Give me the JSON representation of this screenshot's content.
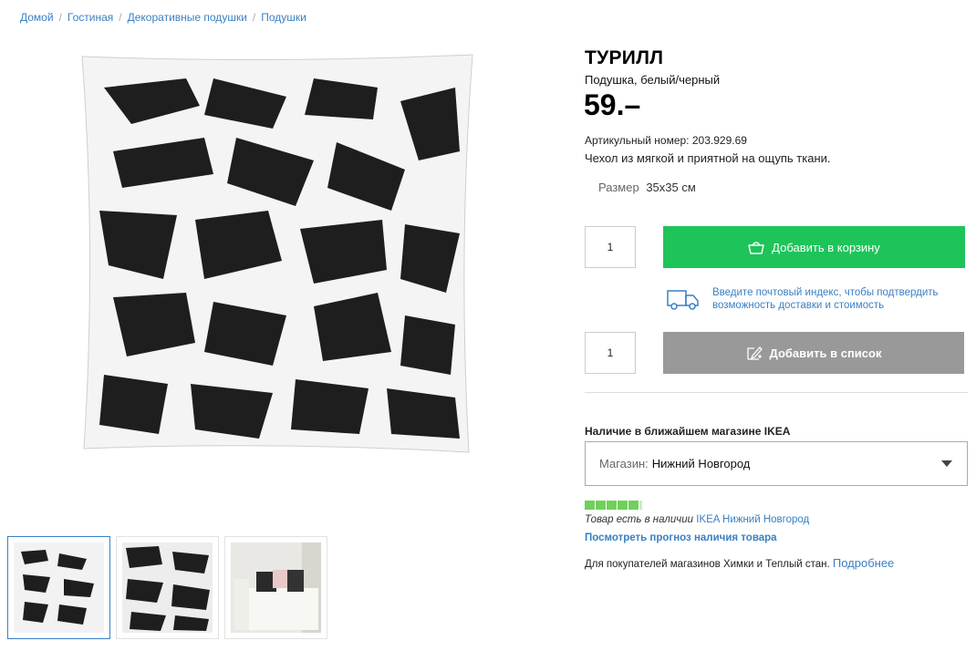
{
  "breadcrumb": {
    "items": [
      "Домой",
      "Гостиная",
      "Декоративные подушки",
      "Подушки"
    ],
    "separator": "/"
  },
  "product": {
    "name": "ТУРИЛЛ",
    "subtitle": "Подушка, белый/черный",
    "price": "59.–",
    "article_label": "Артикульный номер:",
    "article_number": "203.929.69",
    "description": "Чехол из мягкой и приятной на ощупь ткани.",
    "size_label": "Размер",
    "size_value": "35x35 см"
  },
  "cart": {
    "quantity": "1",
    "add_to_cart_label": "Добавить в корзину",
    "button_color": "#1ec45a",
    "icon": "basket-icon"
  },
  "delivery": {
    "text": "Введите почтовый индекс, чтобы подтвердить возможность доставки и стоимость",
    "icon": "truck-icon"
  },
  "list": {
    "quantity": "1",
    "add_to_list_label": "Добавить в список",
    "button_color": "#999999",
    "icon": "list-pen-icon"
  },
  "store": {
    "heading": "Наличие в ближайшем магазине IKEA",
    "select_label": "Магазин:",
    "select_value": "Нижний Новгород",
    "stock_level": 0.9,
    "stock_text": "Товар есть в наличии",
    "stock_store_link": "IKEA Нижний Новгород",
    "forecast_link": "Посмотреть прогноз наличия товара",
    "buyers_text": "Для покупателей магазинов Химки и Теплый стан.",
    "buyers_link": "Подробнее"
  },
  "colors": {
    "link": "#3a80c3",
    "accent_green": "#1ec45a",
    "stock_green": "#6fd05a"
  }
}
